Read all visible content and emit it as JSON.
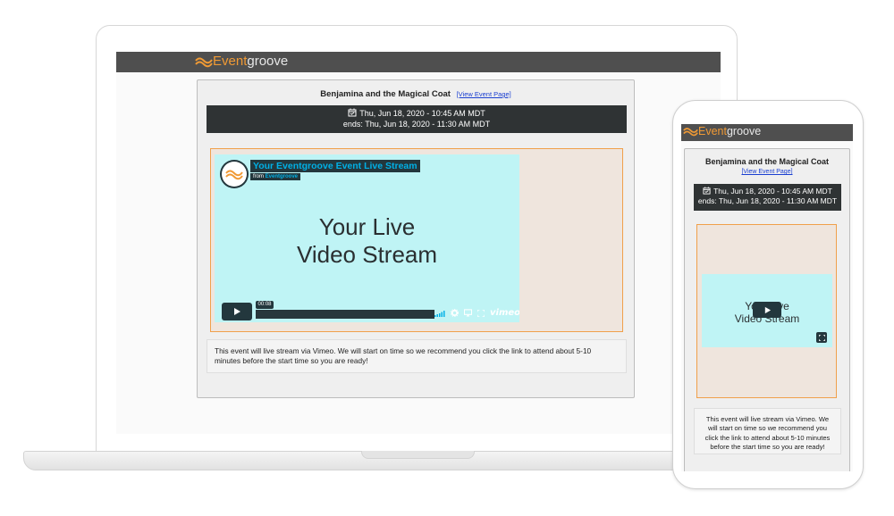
{
  "brand": {
    "name_accent": "Event",
    "name_rest": "groove",
    "accent_color": "#f09a35",
    "topbar_color": "#4f4f4f"
  },
  "event": {
    "title": "Benjamina and the Magical Coat",
    "view_link": "[View Event Page]",
    "starts": "Thu, Jun 18, 2020 - 10:45 AM MDT",
    "ends": "ends: Thu, Jun 18, 2020 - 11:30 AM MDT",
    "description": "This event will live stream via Vimeo. We will start on time so we recommend you click the link to attend about 5-10 minutes before the start time so you are ready!"
  },
  "video": {
    "title": "Your Eventgroove Event Live Stream",
    "from_prefix": "from",
    "from_channel": "Eventgroove",
    "caption_line1": "Your Live",
    "caption_line2": "Video Stream",
    "timestamp": "00:08",
    "player_word": "vimeo",
    "background_color": "#bff4f5",
    "controls_color": "#23373d",
    "frame_border_color": "#f0a04b",
    "icons": [
      "play-icon",
      "volume-icon",
      "settings-icon",
      "airplay-icon",
      "fullscreen-icon"
    ]
  }
}
